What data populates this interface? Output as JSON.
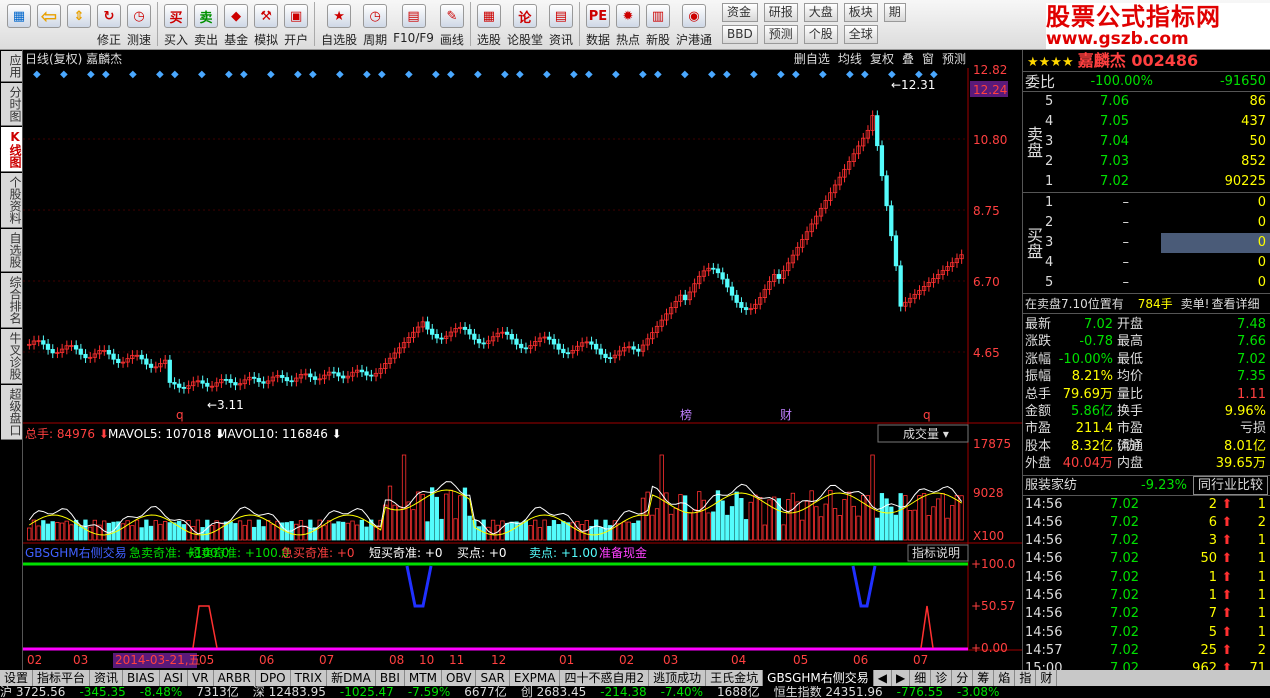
{
  "toolbar": {
    "buttons": [
      {
        "label": "修正",
        "icon": "refresh-icon"
      },
      {
        "label": "测速",
        "icon": "clock-icon"
      },
      {
        "label": "买入",
        "glyph": "买"
      },
      {
        "label": "卖出",
        "glyph": "卖"
      },
      {
        "label": "基金",
        "icon": "fund-icon"
      },
      {
        "label": "模拟",
        "icon": "hammer-icon"
      },
      {
        "label": "开户",
        "icon": "lock-icon"
      },
      {
        "label": "自选股",
        "icon": "star-icon"
      },
      {
        "label": "周期",
        "icon": "clock-icon"
      },
      {
        "label": "F10/F9",
        "icon": "f10-icon"
      },
      {
        "label": "画线",
        "icon": "pen-icon"
      },
      {
        "label": "选股",
        "icon": "screen-icon"
      },
      {
        "label": "论股堂",
        "glyph": "论"
      },
      {
        "label": "资讯",
        "icon": "news-icon"
      },
      {
        "label": "数据",
        "glyph": "PE"
      },
      {
        "label": "热点",
        "icon": "fire-icon"
      },
      {
        "label": "新股",
        "icon": "doc-icon"
      },
      {
        "label": "沪港通",
        "icon": "hk-icon"
      }
    ],
    "small_buttons": [
      [
        "资金",
        "BBD"
      ],
      [
        "研报",
        "预测"
      ],
      [
        "大盘",
        "个股"
      ],
      [
        "板块",
        "全球"
      ],
      [
        "期"
      ]
    ],
    "brand_title": "股票公式指标网",
    "brand_url": "www.gszb.com"
  },
  "left_tabs": [
    {
      "label": "应用"
    },
    {
      "label": "分时图"
    },
    {
      "label": "K线图",
      "active": true
    },
    {
      "label": "个股资料"
    },
    {
      "label": "自选股"
    },
    {
      "label": "综合排名"
    },
    {
      "label": "牛叉诊股"
    },
    {
      "label": "超级盘口"
    }
  ],
  "chart": {
    "header_left": "日线(复权) 嘉麟杰",
    "header_buttons": [
      "删自选",
      "均线",
      "复权",
      "叠",
      "窗",
      "预测"
    ],
    "price_axis": [
      "12.82",
      "12.24",
      "10.80",
      "8.75",
      "6.70",
      "4.65"
    ],
    "high_label": "12.31",
    "low_label": "3.11",
    "markers": [
      "q",
      "榜",
      "财",
      "q"
    ],
    "volume_legend": {
      "total": "总手: 84976",
      "ma5": "MAVOL5: 107018",
      "ma10": "MAVOL10: 116846"
    },
    "volume_selector": "成交量",
    "volume_axis": [
      "17875",
      "9028",
      "X100"
    ],
    "indicator_legend": [
      "GBSGHM右侧交易",
      "急卖奇准: +100.0",
      "短卖奇准: +100.0",
      "急买奇准: +0",
      "短买奇准: +0",
      "买点: +0",
      "卖点: +1.00",
      "准备现金"
    ],
    "indicator_button": "指标说明",
    "indicator_axis": [
      "+100.0",
      "+50.57",
      "+0.00"
    ],
    "date_axis": [
      "02",
      "03",
      "2014-03-21,五",
      "05",
      "06",
      "07",
      "08",
      "10",
      "11",
      "12",
      "01",
      "02",
      "03",
      "04",
      "05",
      "06",
      "07"
    ]
  },
  "right": {
    "header": "嘉麟杰 002486",
    "weibi": {
      "label": "委比",
      "pct": "-100.00%",
      "diff": "-91650"
    },
    "sell_label": "卖盘",
    "sell": [
      {
        "lv": "5",
        "price": "7.06",
        "vol": "86"
      },
      {
        "lv": "4",
        "price": "7.05",
        "vol": "437"
      },
      {
        "lv": "3",
        "price": "7.04",
        "vol": "50"
      },
      {
        "lv": "2",
        "price": "7.03",
        "vol": "852"
      },
      {
        "lv": "1",
        "price": "7.02",
        "vol": "90225"
      }
    ],
    "buy_label": "买盘",
    "buy": [
      {
        "lv": "1",
        "price": "–",
        "vol": "0"
      },
      {
        "lv": "2",
        "price": "–",
        "vol": "0"
      },
      {
        "lv": "3",
        "price": "–",
        "vol": "0"
      },
      {
        "lv": "4",
        "price": "–",
        "vol": "0"
      },
      {
        "lv": "5",
        "price": "–",
        "vol": "0"
      }
    ],
    "info_line": {
      "a": "在卖盘7.10位置有",
      "b": "784手",
      "c": "卖单!",
      "d": "查看详细"
    },
    "quote": [
      {
        "k": "最新",
        "v": "7.02",
        "k2": "开盘",
        "v2": "7.48"
      },
      {
        "k": "涨跌",
        "v": "-0.78",
        "k2": "最高",
        "v2": "7.66"
      },
      {
        "k": "涨幅",
        "v": "-10.00%",
        "k2": "最低",
        "v2": "7.02"
      },
      {
        "k": "振幅",
        "v": "8.21%",
        "k2": "均价",
        "v2": "7.35"
      },
      {
        "k": "总手",
        "v": "79.69万",
        "k2": "量比",
        "v2": "1.11"
      },
      {
        "k": "金额",
        "v": "5.86亿",
        "k2": "换手",
        "v2": "9.96%"
      },
      {
        "k": "市盈",
        "v": "211.4",
        "k2": "市盈(动)",
        "v2": "亏损"
      },
      {
        "k": "股本",
        "v": "8.32亿",
        "k2": "流通",
        "v2": "8.01亿"
      },
      {
        "k": "外盘",
        "v": "40.04万",
        "k2": "内盘",
        "v2": "39.65万"
      }
    ],
    "industry": {
      "name": "服装家纺",
      "pct": "-9.23%",
      "btn": "同行业比较"
    },
    "ticks": [
      {
        "t": "14:56",
        "p": "7.02",
        "v": "2",
        "n": "1"
      },
      {
        "t": "14:56",
        "p": "7.02",
        "v": "6",
        "n": "2"
      },
      {
        "t": "14:56",
        "p": "7.02",
        "v": "3",
        "n": "1"
      },
      {
        "t": "14:56",
        "p": "7.02",
        "v": "50",
        "n": "1"
      },
      {
        "t": "14:56",
        "p": "7.02",
        "v": "1",
        "n": "1"
      },
      {
        "t": "14:56",
        "p": "7.02",
        "v": "1",
        "n": "1"
      },
      {
        "t": "14:56",
        "p": "7.02",
        "v": "7",
        "n": "1"
      },
      {
        "t": "14:56",
        "p": "7.02",
        "v": "5",
        "n": "1"
      },
      {
        "t": "14:57",
        "p": "7.02",
        "v": "25",
        "n": "2"
      },
      {
        "t": "15:00",
        "p": "7.02",
        "v": "962",
        "n": "71"
      }
    ]
  },
  "bottom_tabs": [
    "设置",
    "指标平台",
    "资讯",
    "BIAS",
    "ASI",
    "VR",
    "ARBR",
    "DPO",
    "TRIX",
    "新DMA",
    "BBI",
    "MTM",
    "OBV",
    "SAR",
    "EXPMA",
    "四十不惑自用2",
    "逃顶成功",
    "王氏金坑",
    "GBSGHM右侧交易",
    "◀",
    "▶",
    "细",
    "诊",
    "分",
    "筹",
    "焰",
    "指",
    "财"
  ],
  "bottom_active": "GBSGHM右侧交易",
  "status": [
    "沪 3725.56",
    "-345.35",
    "-8.48%",
    "7313亿",
    "深 12483.95",
    "-1025.47",
    "-7.59%",
    "6677亿",
    "创 2683.45",
    "-214.38",
    "-7.40%",
    "1688亿",
    "恒生指数 24351.96",
    "-776.55",
    "-3.08%"
  ]
}
